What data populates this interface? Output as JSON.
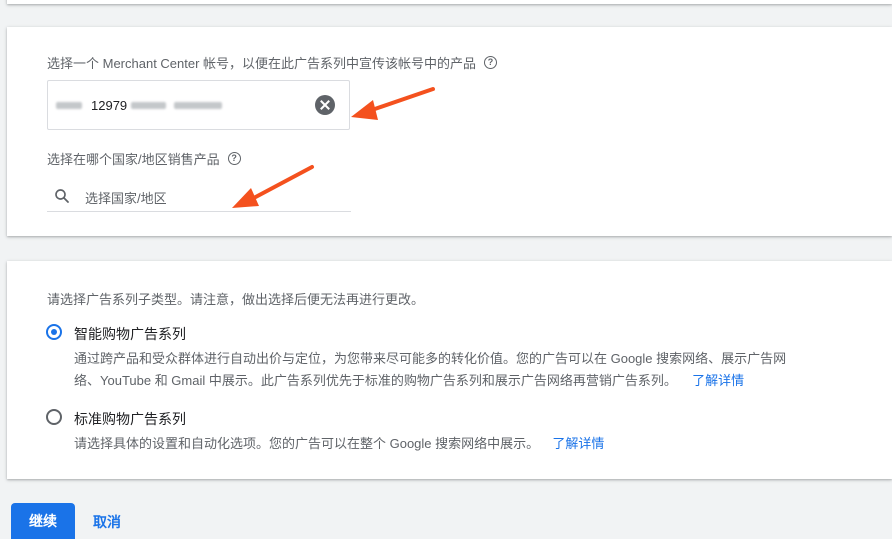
{
  "merchant_section": {
    "account_label": "选择一个 Merchant Center 帐号，以便在此广告系列中宣传该帐号中的产品",
    "account_value": "12979",
    "country_label": "选择在哪个国家/地区销售产品",
    "country_placeholder": "选择国家/地区"
  },
  "subtype_section": {
    "prompt": "请选择广告系列子类型。请注意，做出选择后便无法再进行更改。",
    "options": [
      {
        "title": "智能购物广告系列",
        "selected": true,
        "desc_line1": "通过跨产品和受众群体进行自动出价与定位，为您带来尽可能多的转化价值。您的广告可以在 Google 搜索网络、展示广告网",
        "desc_line2": "络、YouTube 和 Gmail 中展示。此广告系列优先于标准的购物广告系列和展示广告网络再营销广告系列。",
        "link": "了解详情"
      },
      {
        "title": "标准购物广告系列",
        "selected": false,
        "desc_line1": "请选择具体的设置和自动化选项。您的广告可以在整个 Google 搜索网络中展示。",
        "link": "了解详情"
      }
    ]
  },
  "actions": {
    "continue_label": "继续",
    "cancel_label": "取消"
  },
  "colors": {
    "accent": "#1a73e8",
    "annotation_arrow": "#f4511e"
  },
  "icons": {
    "help": "help-icon",
    "clear": "clear-icon",
    "search": "search-icon"
  }
}
